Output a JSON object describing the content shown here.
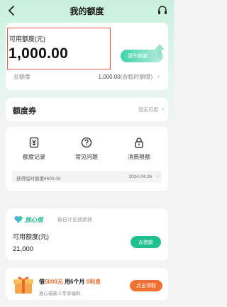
{
  "header": {
    "title": "我的额度"
  },
  "quota": {
    "label": "可用额度(元)",
    "value": "1,000.00",
    "raise_button": "提升额度",
    "total_label": "总额度",
    "total_value": "1,000.00",
    "total_note": "(含临时额度)"
  },
  "coupon": {
    "title": "额度券",
    "status": "暂无可用"
  },
  "menu": {
    "items": [
      {
        "label": "额度记录",
        "icon": "yen-doc-icon"
      },
      {
        "label": "常见问题",
        "icon": "question-icon"
      },
      {
        "label": "消费限额",
        "icon": "lock-icon"
      }
    ],
    "tip": {
      "text": "获得临时额度¥500.00",
      "date": "2024.04.26"
    }
  },
  "loan": {
    "brand": "放心借",
    "tagline": "按日计息放款快",
    "label": "可用额度(元)",
    "value": "21,000",
    "button": "去借款"
  },
  "promo": {
    "prefix": "借",
    "amount": "5000元",
    "middle": " 用6个月 ",
    "interest": "0利息",
    "subtitle": "放心借新人专享福利",
    "button": "点击领取"
  },
  "colors": {
    "accent": "#1fbf8f",
    "highlight": "#e4554d",
    "promo": "#f07032"
  }
}
